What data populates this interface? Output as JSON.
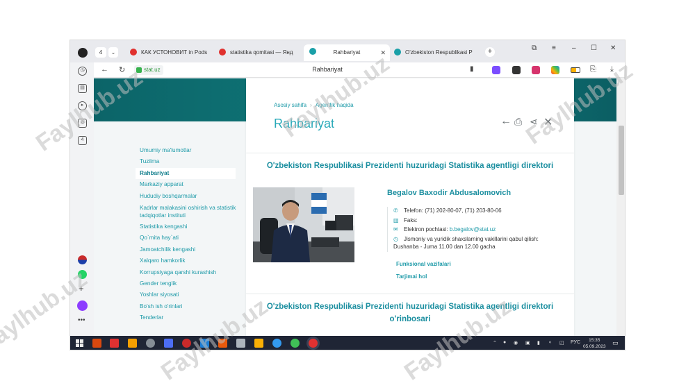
{
  "browser": {
    "tab_count": "4",
    "tabs": [
      {
        "label": "КАК УСТОНОВИТ in Pods",
        "color": "#e0312e"
      },
      {
        "label": "statistika qomitasi — Янд",
        "color": "#e0312e"
      },
      {
        "label": "Rahbariyat",
        "color": "#1aa0a8"
      },
      {
        "label": "O'zbekiston Respublikasi P",
        "color": "#1aa0a8"
      }
    ],
    "url": "stat.uz",
    "page_title": "Rahbariyat",
    "vertical_badge": "4"
  },
  "leftnav": {
    "items": [
      "Umumiy ma'lumotlar",
      "Tuzilma",
      "Rahbariyat",
      "Markaziy apparat",
      "Hududiy boshqarmalar",
      "Kadrlar malakasini oshirish va statistik tadqiqotlar instituti",
      "Statistika kengashi",
      "Qo`mita hay`ati",
      "Jamoatchilik kengashi",
      "Xalqaro hamkorlik",
      "Korrupsiyaga qarshi kurashish",
      "Gender tenglik",
      "Yoshlar siyosati",
      "Bo'sh ish o'rinlari",
      "Tenderlar"
    ]
  },
  "content": {
    "breadcrumb_home": "Asosiy sahifa",
    "breadcrumb_current": "Agentlik haqida",
    "title": "Rahbariyat",
    "section_director": "O'zbekiston Respublikasi Prezidenti huzuridagi Statistika agentligi direktori",
    "person_name": "Begalov Baxodir Abdusalomovich",
    "phone": "Telefon: (71) 202-80-07, (71) 203-80-06",
    "fax": "Faks:",
    "email_label": "Elektron pochtasi:",
    "email": "b.begalov@stat.uz",
    "reception": "Jismoniy va yuridik shaxslarning vakillarini qabul qilish: Dushanba - Juma 11.00 dan 12.00 gacha",
    "link_duties": "Funksional vazifalari",
    "link_bio": "Tarjimai hol",
    "section_deputy": "O'zbekiston Respublikasi Prezidenti huzuridagi Statistika agentligi direktori o'rinbosari"
  },
  "taskbar": {
    "lang": "РУС",
    "time": "15:35",
    "date": "05.09.2023"
  },
  "watermark": "Faylhub.uz"
}
